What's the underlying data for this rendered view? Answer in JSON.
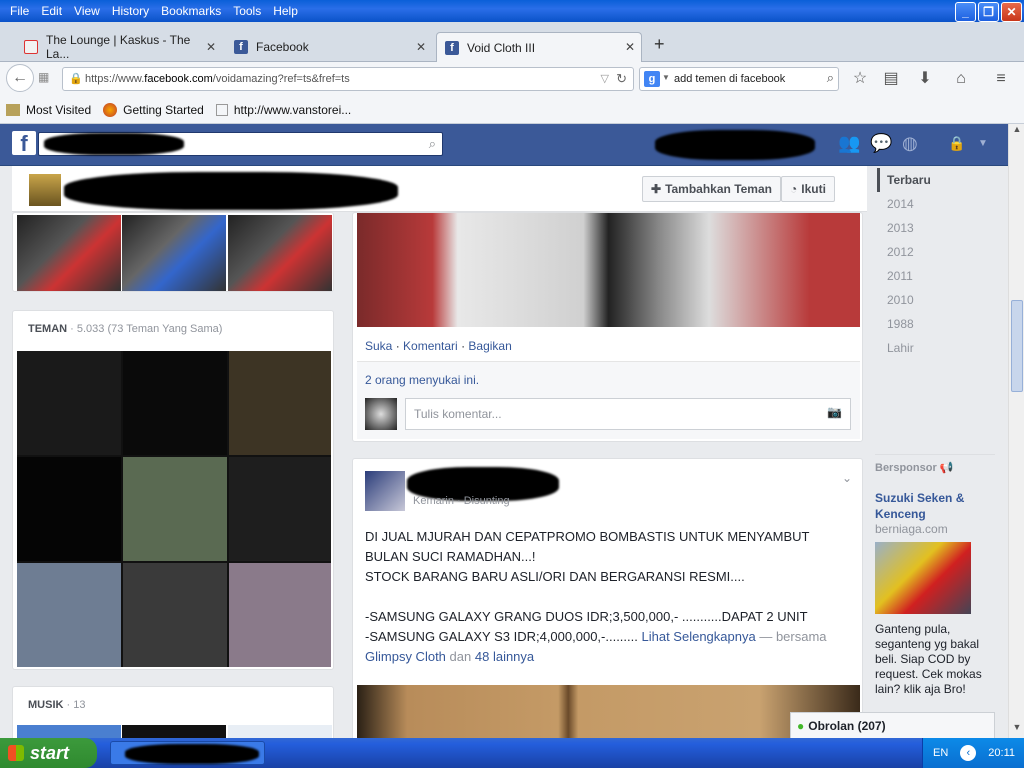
{
  "menu": [
    "File",
    "Edit",
    "View",
    "History",
    "Bookmarks",
    "Tools",
    "Help"
  ],
  "tabs": [
    {
      "title": "The Lounge | Kaskus - The La...",
      "icon": "kaskus-icon",
      "active": false
    },
    {
      "title": "Facebook",
      "icon": "facebook-icon",
      "active": false
    },
    {
      "title": "Void Cloth III",
      "icon": "facebook-icon",
      "active": true
    }
  ],
  "nav": {
    "url_prefix": "https://www.",
    "url_domain": "facebook.com",
    "url_path": "/voidamazing?ref=ts&fref=ts",
    "search_value": "add temen di facebook"
  },
  "bookmarks": [
    "Most Visited",
    "Getting Started",
    "http://www.vanstorei..."
  ],
  "profile": {
    "add_friend": "Tambahkan Teman",
    "follow": "Ikuti"
  },
  "friends": {
    "label": "TEMAN",
    "count": " · 5.033 (73 Teman Yang Sama)"
  },
  "music": {
    "label": "MUSIK",
    "count": " · 13"
  },
  "post1": {
    "actions": [
      "Suka",
      "Komentari",
      "Bagikan"
    ],
    "likes": "2 orang menyukai ini.",
    "comment_placeholder": "Tulis komentar..."
  },
  "post2": {
    "subtitle": "Kemarin · Disunting",
    "lines": [
      "DI JUAL MJURAH DAN CEPATPROMO BOMBASTIS UNTUK MENYAMBUT",
      "BULAN SUCI RAMADHAN...!",
      "STOCK BARANG BARU ASLI/ORI DAN BERGARANSI RESMI...."
    ],
    "line4": "-SAMSUNG GALAXY GRANG DUOS IDR;3,500,000,- ...........DAPAT 2 UNIT",
    "line5": "-SAMSUNG GALAXY S3 IDR;4,000,000,-.........",
    "see_more": "Lihat Selengkapnya",
    "with_prefix": "— bersama",
    "tagged": "Glimpsy Cloth",
    "and": "dan",
    "others": "48 lainnya"
  },
  "years": [
    "Terbaru",
    "2014",
    "2013",
    "2012",
    "2011",
    "2010",
    "1988",
    "Lahir"
  ],
  "sponsored": {
    "label": "Bersponsor",
    "title": "Suzuki Seken & Kenceng",
    "domain": "berniaga.com",
    "text": "Ganteng pula, seganteng yg bakal beli. Siap COD by request. Cek mokas lain? klik aja Bro!"
  },
  "chat": {
    "label": "Obrolan (207)"
  },
  "taskbar": {
    "start": "start",
    "lang": "EN",
    "time": "20:11"
  }
}
